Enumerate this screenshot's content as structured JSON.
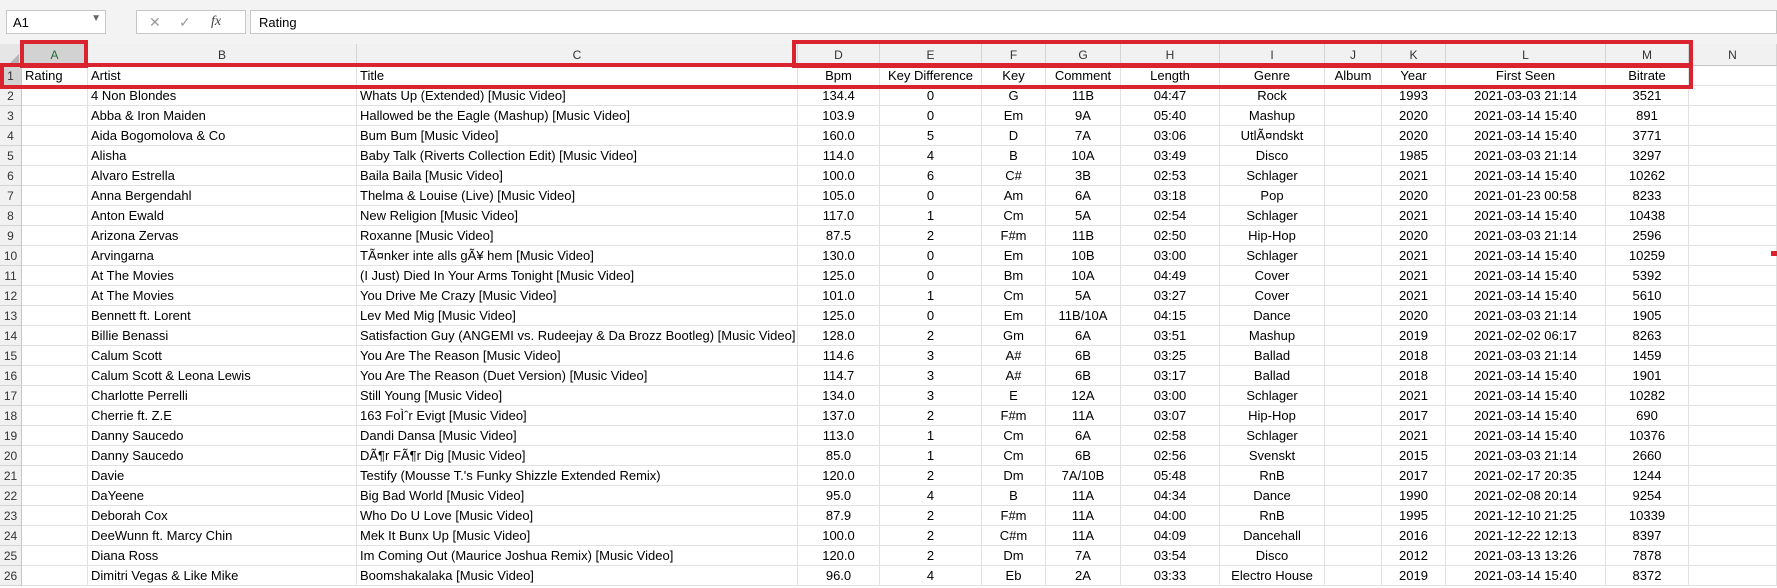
{
  "formula_bar": {
    "name_box": "A1",
    "formula_value": "Rating"
  },
  "icons": {
    "cancel": "close-icon",
    "confirm": "check-icon",
    "function": "function-icon"
  },
  "columns": [
    "A",
    "B",
    "C",
    "D",
    "E",
    "F",
    "G",
    "H",
    "I",
    "J",
    "K",
    "L",
    "M",
    "N"
  ],
  "row_numbers": [
    "1",
    "2",
    "3",
    "4",
    "5",
    "6",
    "7",
    "8",
    "9",
    "10",
    "11",
    "12",
    "13",
    "14",
    "15",
    "16",
    "17",
    "18",
    "19",
    "20",
    "21",
    "22",
    "23",
    "24",
    "25",
    "26"
  ],
  "headers": [
    "Rating",
    "Artist",
    "Title",
    "Bpm",
    "Key Difference",
    "Key",
    "Comment",
    "Length",
    "Genre",
    "Album",
    "Year",
    "First Seen",
    "Bitrate",
    ""
  ],
  "rows": [
    [
      "",
      "4 Non Blondes",
      "Whats Up (Extended) [Music Video]",
      "134.4",
      "0",
      "G",
      "11B",
      "04:47",
      "Rock",
      "",
      "1993",
      "2021-03-03 21:14",
      "3521",
      ""
    ],
    [
      "",
      "Abba & Iron Maiden",
      "Hallowed be the Eagle (Mashup) [Music Video]",
      "103.9",
      "0",
      "Em",
      "9A",
      "05:40",
      "Mashup",
      "",
      "2020",
      "2021-03-14 15:40",
      "891",
      ""
    ],
    [
      "",
      "Aida Bogomolova & Co",
      "Bum Bum [Music Video]",
      "160.0",
      "5",
      "D",
      "7A",
      "03:06",
      "UtlÃ¤ndskt",
      "",
      "2020",
      "2021-03-14 15:40",
      "3771",
      ""
    ],
    [
      "",
      "Alisha",
      "Baby Talk (Riverts Collection Edit) [Music Video]",
      "114.0",
      "4",
      "B",
      "10A",
      "03:49",
      "Disco",
      "",
      "1985",
      "2021-03-03 21:14",
      "3297",
      ""
    ],
    [
      "",
      "Alvaro Estrella",
      "Baila Baila [Music Video]",
      "100.0",
      "6",
      "C#",
      "3B",
      "02:53",
      "Schlager",
      "",
      "2021",
      "2021-03-14 15:40",
      "10262",
      ""
    ],
    [
      "",
      "Anna Bergendahl",
      "Thelma & Louise (Live) [Music Video]",
      "105.0",
      "0",
      "Am",
      "6A",
      "03:18",
      "Pop",
      "",
      "2020",
      "2021-01-23 00:58",
      "8233",
      ""
    ],
    [
      "",
      "Anton Ewald",
      "New Religion [Music Video]",
      "117.0",
      "1",
      "Cm",
      "5A",
      "02:54",
      "Schlager",
      "",
      "2021",
      "2021-03-14 15:40",
      "10438",
      ""
    ],
    [
      "",
      "Arizona Zervas",
      "Roxanne [Music Video]",
      "87.5",
      "2",
      "F#m",
      "11B",
      "02:50",
      "Hip-Hop",
      "",
      "2020",
      "2021-03-03 21:14",
      "2596",
      ""
    ],
    [
      "",
      "Arvingarna",
      "TÃ¤nker inte alls gÃ¥ hem [Music Video]",
      "130.0",
      "0",
      "Em",
      "10B",
      "03:00",
      "Schlager",
      "",
      "2021",
      "2021-03-14 15:40",
      "10259",
      ""
    ],
    [
      "",
      "At The Movies",
      "(I Just) Died In Your Arms Tonight [Music Video]",
      "125.0",
      "0",
      "Bm",
      "10A",
      "04:49",
      "Cover",
      "",
      "2021",
      "2021-03-14 15:40",
      "5392",
      ""
    ],
    [
      "",
      "At The Movies",
      "You Drive Me Crazy [Music Video]",
      "101.0",
      "1",
      "Cm",
      "5A",
      "03:27",
      "Cover",
      "",
      "2021",
      "2021-03-14 15:40",
      "5610",
      ""
    ],
    [
      "",
      "Bennett ft. Lorent",
      "Lev Med Mig [Music Video]",
      "125.0",
      "0",
      "Em",
      "11B/10A",
      "04:15",
      "Dance",
      "",
      "2020",
      "2021-03-03 21:14",
      "1905",
      ""
    ],
    [
      "",
      "Billie Benassi",
      "Satisfaction Guy (ANGEMI vs. Rudeejay & Da Brozz Bootleg) [Music Video]",
      "128.0",
      "2",
      "Gm",
      "6A",
      "03:51",
      "Mashup",
      "",
      "2019",
      "2021-02-02 06:17",
      "8263",
      ""
    ],
    [
      "",
      "Calum Scott",
      "You Are The Reason [Music Video]",
      "114.6",
      "3",
      "A#",
      "6B",
      "03:25",
      "Ballad",
      "",
      "2018",
      "2021-03-03 21:14",
      "1459",
      ""
    ],
    [
      "",
      "Calum Scott & Leona Lewis",
      "You Are The Reason (Duet Version) [Music Video]",
      "114.7",
      "3",
      "A#",
      "6B",
      "03:17",
      "Ballad",
      "",
      "2018",
      "2021-03-14 15:40",
      "1901",
      ""
    ],
    [
      "",
      "Charlotte Perrelli",
      "Still Young [Music Video]",
      "134.0",
      "3",
      "E",
      "12A",
      "03:00",
      "Schlager",
      "",
      "2021",
      "2021-03-14 15:40",
      "10282",
      ""
    ],
    [
      "",
      "Cherrie ft. Z.E",
      "163 FoÌˆr Evigt [Music Video]",
      "137.0",
      "2",
      "F#m",
      "11A",
      "03:07",
      "Hip-Hop",
      "",
      "2017",
      "2021-03-14 15:40",
      "690",
      ""
    ],
    [
      "",
      "Danny Saucedo",
      "Dandi Dansa [Music Video]",
      "113.0",
      "1",
      "Cm",
      "6A",
      "02:58",
      "Schlager",
      "",
      "2021",
      "2021-03-14 15:40",
      "10376",
      ""
    ],
    [
      "",
      "Danny Saucedo",
      "DÃ¶r FÃ¶r Dig [Music Video]",
      "85.0",
      "1",
      "Cm",
      "6B",
      "02:56",
      "Svenskt",
      "",
      "2015",
      "2021-03-03 21:14",
      "2660",
      ""
    ],
    [
      "",
      "Davie",
      "Testify (Mousse T.'s Funky Shizzle Extended Remix)",
      "120.0",
      "2",
      "Dm",
      "7A/10B",
      "05:48",
      "RnB",
      "",
      "2017",
      "2021-02-17 20:35",
      "1244",
      ""
    ],
    [
      "",
      "DaYeene",
      "Big Bad World [Music Video]",
      "95.0",
      "4",
      "B",
      "11A",
      "04:34",
      "Dance",
      "",
      "1990",
      "2021-02-08 20:14",
      "9254",
      ""
    ],
    [
      "",
      "Deborah Cox",
      "Who Do U Love [Music Video]",
      "87.9",
      "2",
      "F#m",
      "11A",
      "04:00",
      "RnB",
      "",
      "1995",
      "2021-12-10 21:25",
      "10339",
      ""
    ],
    [
      "",
      "DeeWunn ft. Marcy Chin",
      "Mek It Bunx Up [Music Video]",
      "100.0",
      "2",
      "C#m",
      "11A",
      "04:09",
      "Dancehall",
      "",
      "2016",
      "2021-12-22 12:13",
      "8397",
      ""
    ],
    [
      "",
      "Diana Ross",
      "Im Coming Out (Maurice Joshua Remix) [Music Video]",
      "120.0",
      "2",
      "Dm",
      "7A",
      "03:54",
      "Disco",
      "",
      "2012",
      "2021-03-13 13:26",
      "7878",
      ""
    ],
    [
      "",
      "Dimitri Vegas & Like Mike",
      "Boomshakalaka [Music Video]",
      "96.0",
      "4",
      "Eb",
      "2A",
      "03:33",
      "Electro House",
      "",
      "2019",
      "2021-03-14 15:40",
      "8372",
      ""
    ]
  ],
  "colors": {
    "highlight": "#d9232e",
    "header_bg": "#f1f1f1",
    "selected_header_bg": "#d2d2d2"
  }
}
